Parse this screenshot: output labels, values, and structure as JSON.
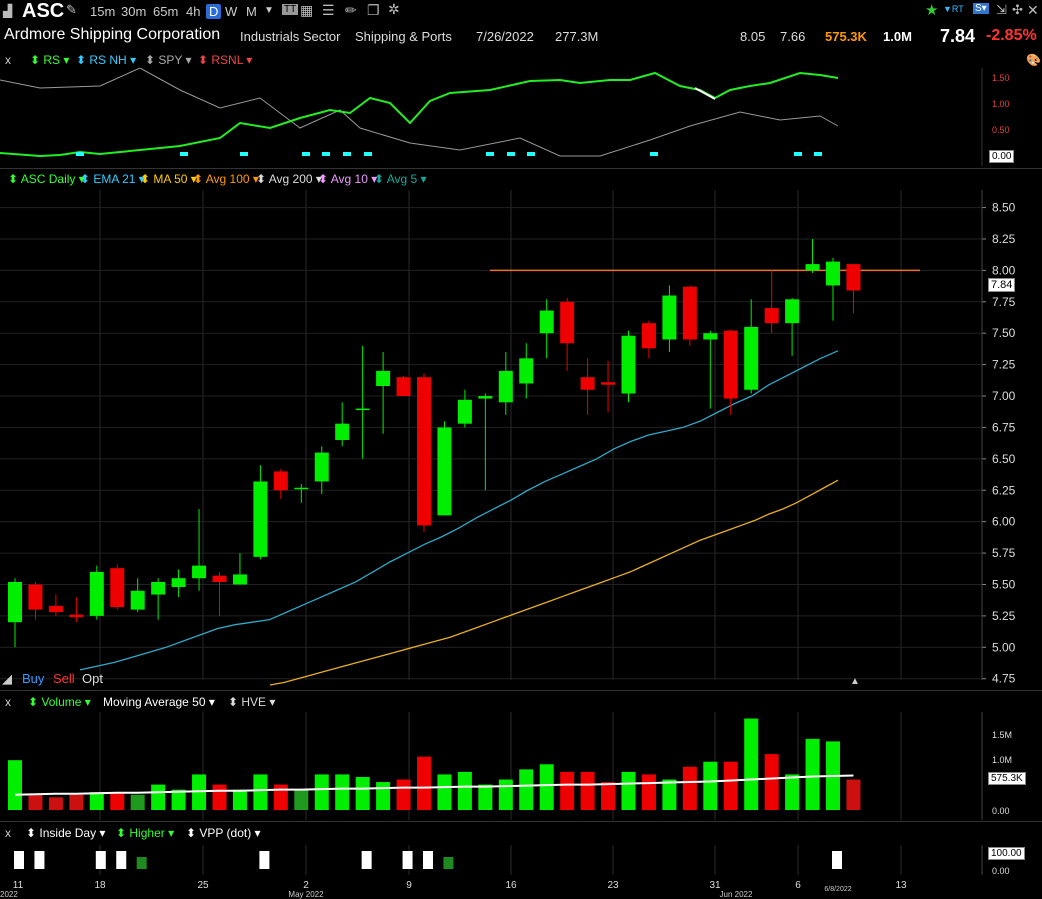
{
  "toolbar": {
    "symbol": "ASC",
    "timeframes": [
      "15m",
      "30m",
      "65m",
      "4h",
      "D",
      "W",
      "M"
    ],
    "active_timeframe": "D"
  },
  "info": {
    "company": "Ardmore Shipping Corporation",
    "sector": "Industrials Sector",
    "industry": "Shipping & Ports",
    "date": "7/26/2022",
    "market_cap": "277.3M",
    "high": "8.05",
    "low": "7.66",
    "volume": "575.3K",
    "avg_volume": "1.0M",
    "last": "7.84",
    "change_pct": "-2.85%"
  },
  "rs_pane": {
    "indicators": [
      "RS",
      "RS NH",
      "SPY",
      "RSNL"
    ],
    "axis": [
      "1.50",
      "1.00",
      "0.50",
      "0.00"
    ],
    "value_box": "0.00"
  },
  "price_pane": {
    "indicators": [
      "ASC Daily",
      "EMA 21",
      "MA 50",
      "Avg 100",
      "Avg 200",
      "Avg 10",
      "Avg 5"
    ],
    "axis": [
      "8.50",
      "8.25",
      "8.00",
      "7.75",
      "7.50",
      "7.25",
      "7.00",
      "6.75",
      "6.50",
      "6.25",
      "6.00",
      "5.75",
      "5.50",
      "5.25",
      "5.00",
      "4.75"
    ],
    "last_box": "7.84",
    "trade_buttons": [
      "Buy",
      "Sell",
      "Opt"
    ]
  },
  "volume_pane": {
    "indicators": [
      "Volume",
      "Moving Average 50",
      "HVE"
    ],
    "axis": [
      "1.5M",
      "1.0M",
      "0.00"
    ],
    "value_box": "575.3K"
  },
  "bottom_pane": {
    "indicators": [
      "Inside Day",
      "Higher",
      "VPP (dot)"
    ],
    "axis": [
      "100.00",
      "0.00"
    ],
    "value_box": "100.00"
  },
  "x_axis": {
    "days": [
      "11",
      "18",
      "25",
      "2",
      "9",
      "16",
      "23",
      "31",
      "6",
      "13"
    ],
    "months": [
      "2022",
      "May 2022",
      "Jun 2022"
    ],
    "cursor_date": "6/8/2022"
  },
  "chart_data": {
    "type": "candlestick",
    "ylim": [
      4.7,
      8.6
    ],
    "resistance": 8.0,
    "candles": [
      {
        "o": 5.2,
        "h": 5.55,
        "l": 5.0,
        "c": 5.52
      },
      {
        "o": 5.5,
        "h": 5.52,
        "l": 5.22,
        "c": 5.3
      },
      {
        "o": 5.33,
        "h": 5.42,
        "l": 5.25,
        "c": 5.28
      },
      {
        "o": 5.26,
        "h": 5.4,
        "l": 5.2,
        "c": 5.24
      },
      {
        "o": 5.25,
        "h": 5.65,
        "l": 5.22,
        "c": 5.6
      },
      {
        "o": 5.63,
        "h": 5.66,
        "l": 5.3,
        "c": 5.32
      },
      {
        "o": 5.3,
        "h": 5.55,
        "l": 5.28,
        "c": 5.45
      },
      {
        "o": 5.42,
        "h": 5.55,
        "l": 5.22,
        "c": 5.52
      },
      {
        "o": 5.48,
        "h": 5.62,
        "l": 5.4,
        "c": 5.55
      },
      {
        "o": 5.55,
        "h": 6.1,
        "l": 5.45,
        "c": 5.65
      },
      {
        "o": 5.57,
        "h": 5.6,
        "l": 5.25,
        "c": 5.52
      },
      {
        "o": 5.5,
        "h": 5.75,
        "l": 5.5,
        "c": 5.58
      },
      {
        "o": 5.72,
        "h": 6.45,
        "l": 5.7,
        "c": 6.32
      },
      {
        "o": 6.4,
        "h": 6.42,
        "l": 6.18,
        "c": 6.25
      },
      {
        "o": 6.27,
        "h": 6.3,
        "l": 6.15,
        "c": 6.27
      },
      {
        "o": 6.32,
        "h": 6.6,
        "l": 6.22,
        "c": 6.55
      },
      {
        "o": 6.65,
        "h": 6.95,
        "l": 6.6,
        "c": 6.78
      },
      {
        "o": 6.9,
        "h": 7.4,
        "l": 6.5,
        "c": 6.9
      },
      {
        "o": 7.08,
        "h": 7.35,
        "l": 6.7,
        "c": 7.2
      },
      {
        "o": 7.15,
        "h": 7.16,
        "l": 7.0,
        "c": 7.0
      },
      {
        "o": 7.15,
        "h": 7.18,
        "l": 5.92,
        "c": 5.97
      },
      {
        "o": 6.05,
        "h": 6.8,
        "l": 6.05,
        "c": 6.75
      },
      {
        "o": 6.78,
        "h": 7.05,
        "l": 6.75,
        "c": 6.97
      },
      {
        "o": 6.98,
        "h": 7.02,
        "l": 6.25,
        "c": 7.0
      },
      {
        "o": 6.95,
        "h": 7.35,
        "l": 6.85,
        "c": 7.2
      },
      {
        "o": 7.1,
        "h": 7.42,
        "l": 6.98,
        "c": 7.3
      },
      {
        "o": 7.5,
        "h": 7.77,
        "l": 7.3,
        "c": 7.68
      },
      {
        "o": 7.75,
        "h": 7.78,
        "l": 7.2,
        "c": 7.42
      },
      {
        "o": 7.15,
        "h": 7.3,
        "l": 6.85,
        "c": 7.05
      },
      {
        "o": 7.11,
        "h": 7.28,
        "l": 6.87,
        "c": 7.09
      },
      {
        "o": 7.02,
        "h": 7.52,
        "l": 6.95,
        "c": 7.48
      },
      {
        "o": 7.58,
        "h": 7.6,
        "l": 7.3,
        "c": 7.38
      },
      {
        "o": 7.45,
        "h": 7.88,
        "l": 7.35,
        "c": 7.8
      },
      {
        "o": 7.87,
        "h": 7.88,
        "l": 7.4,
        "c": 7.45
      },
      {
        "o": 7.45,
        "h": 7.52,
        "l": 6.9,
        "c": 7.5
      },
      {
        "o": 7.52,
        "h": 7.53,
        "l": 6.85,
        "c": 6.98
      },
      {
        "o": 7.05,
        "h": 7.77,
        "l": 7.02,
        "c": 7.55
      },
      {
        "o": 7.7,
        "h": 8.0,
        "l": 7.5,
        "c": 7.58
      },
      {
        "o": 7.58,
        "h": 7.78,
        "l": 7.32,
        "c": 7.77
      },
      {
        "o": 8.0,
        "h": 8.25,
        "l": 7.98,
        "c": 8.05
      },
      {
        "o": 7.88,
        "h": 8.1,
        "l": 7.6,
        "c": 8.07
      },
      {
        "o": 8.05,
        "h": 8.05,
        "l": 7.66,
        "c": 7.84
      }
    ],
    "ema21": [
      4.82,
      4.85,
      4.88,
      4.92,
      4.96,
      5.0,
      5.05,
      5.1,
      5.15,
      5.18,
      5.2,
      5.22,
      5.28,
      5.34,
      5.4,
      5.46,
      5.52,
      5.6,
      5.68,
      5.75,
      5.82,
      5.88,
      5.95,
      6.03,
      6.1,
      6.17,
      6.25,
      6.32,
      6.38,
      6.44,
      6.5,
      6.58,
      6.64,
      6.69,
      6.72,
      6.75,
      6.8,
      6.87,
      6.94,
      7.0,
      7.09,
      7.16,
      7.23,
      7.3,
      7.36
    ],
    "ma50": [
      4.7,
      4.72,
      4.75,
      4.78,
      4.81,
      4.84,
      4.87,
      4.9,
      4.93,
      4.96,
      4.99,
      5.02,
      5.05,
      5.08,
      5.12,
      5.16,
      5.2,
      5.24,
      5.28,
      5.32,
      5.36,
      5.4,
      5.44,
      5.48,
      5.52,
      5.56,
      5.6,
      5.65,
      5.7,
      5.75,
      5.8,
      5.85,
      5.89,
      5.93,
      5.97,
      6.01,
      6.06,
      6.1,
      6.15,
      6.21,
      6.27,
      6.33
    ],
    "volume": [
      0.98,
      0.3,
      0.25,
      0.3,
      0.35,
      0.35,
      0.3,
      0.5,
      0.4,
      0.7,
      0.5,
      0.4,
      0.7,
      0.5,
      0.4,
      0.7,
      0.7,
      0.65,
      0.55,
      0.6,
      1.05,
      0.7,
      0.75,
      0.5,
      0.6,
      0.8,
      0.9,
      0.75,
      0.75,
      0.55,
      0.75,
      0.7,
      0.6,
      0.85,
      0.95,
      0.95,
      1.8,
      1.1,
      0.7,
      1.4,
      1.35,
      0.6
    ],
    "vol_ma": [
      0.3,
      0.31,
      0.32,
      0.32,
      0.33,
      0.34,
      0.34,
      0.35,
      0.36,
      0.37,
      0.38,
      0.38,
      0.39,
      0.4,
      0.4,
      0.41,
      0.42,
      0.42,
      0.43,
      0.44,
      0.44,
      0.45,
      0.46,
      0.46,
      0.47,
      0.48,
      0.49,
      0.5,
      0.5,
      0.51,
      0.52,
      0.53,
      0.54,
      0.55,
      0.56,
      0.58,
      0.6,
      0.62,
      0.64,
      0.66,
      0.67,
      0.68
    ]
  }
}
